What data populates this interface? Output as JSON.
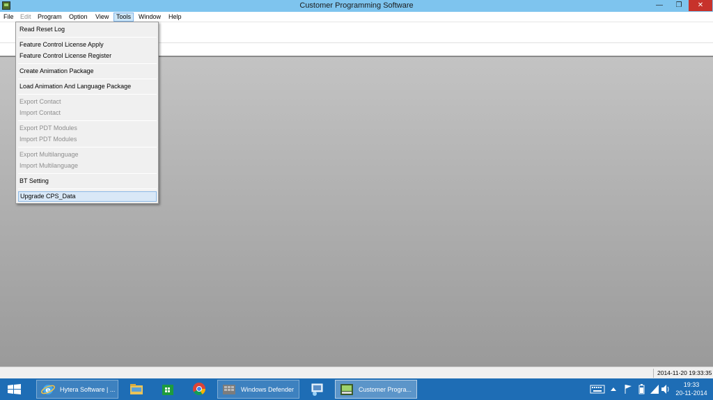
{
  "window": {
    "title": "Customer Programming Software",
    "minimize_glyph": "—",
    "restore_glyph": "❐",
    "close_glyph": "✕"
  },
  "menubar": {
    "items": [
      {
        "label": "File",
        "enabled": true
      },
      {
        "label": "Edit",
        "enabled": false
      },
      {
        "label": "Program",
        "enabled": true
      },
      {
        "label": "Option",
        "enabled": true
      },
      {
        "label": "View",
        "enabled": true
      },
      {
        "label": "Tools",
        "enabled": true,
        "open": true
      },
      {
        "label": "Window",
        "enabled": true
      },
      {
        "label": "Help",
        "enabled": true
      }
    ]
  },
  "tools_menu": {
    "items": [
      {
        "label": "Read Reset Log",
        "enabled": true
      },
      {
        "label": "Feature Control License Apply",
        "enabled": true
      },
      {
        "label": "Feature Control License Register",
        "enabled": true
      },
      {
        "label": "Create Animation Package",
        "enabled": true
      },
      {
        "label": "Load Animation And Language Package",
        "enabled": true
      },
      {
        "label": "Export Contact",
        "enabled": false
      },
      {
        "label": "Import Contact",
        "enabled": false
      },
      {
        "label": "Export PDT Modules",
        "enabled": false
      },
      {
        "label": "Import PDT Modules",
        "enabled": false
      },
      {
        "label": "Export Multilanguage",
        "enabled": false
      },
      {
        "label": "Import Multilanguage",
        "enabled": false
      },
      {
        "label": "BT Setting",
        "enabled": true
      },
      {
        "label": "Upgrade CPS_Data",
        "enabled": true,
        "highlighted": true
      }
    ]
  },
  "statusbar": {
    "datetime": "2014-11-20 19:33:35"
  },
  "taskbar": {
    "items": [
      {
        "label": "Hytera Software | ...",
        "icon": "internet-explorer-icon"
      },
      {
        "label": "",
        "icon": "file-explorer-icon"
      },
      {
        "label": "",
        "icon": "windows-store-icon"
      },
      {
        "label": "",
        "icon": "chrome-icon"
      },
      {
        "label": "Windows Defender",
        "icon": "windows-defender-icon"
      },
      {
        "label": "",
        "icon": "network-settings-icon"
      },
      {
        "label": "Customer Progra...",
        "icon": "cps-app-icon",
        "active": true
      }
    ],
    "clock": {
      "time": "19:33",
      "date": "20-11-2014"
    },
    "tray_icons": [
      "keyboard-icon",
      "show-hidden-icons-icon",
      "battery-icon",
      "action-center-flag-icon",
      "network-icon",
      "volume-icon"
    ],
    "accent": "#1e6db5"
  }
}
